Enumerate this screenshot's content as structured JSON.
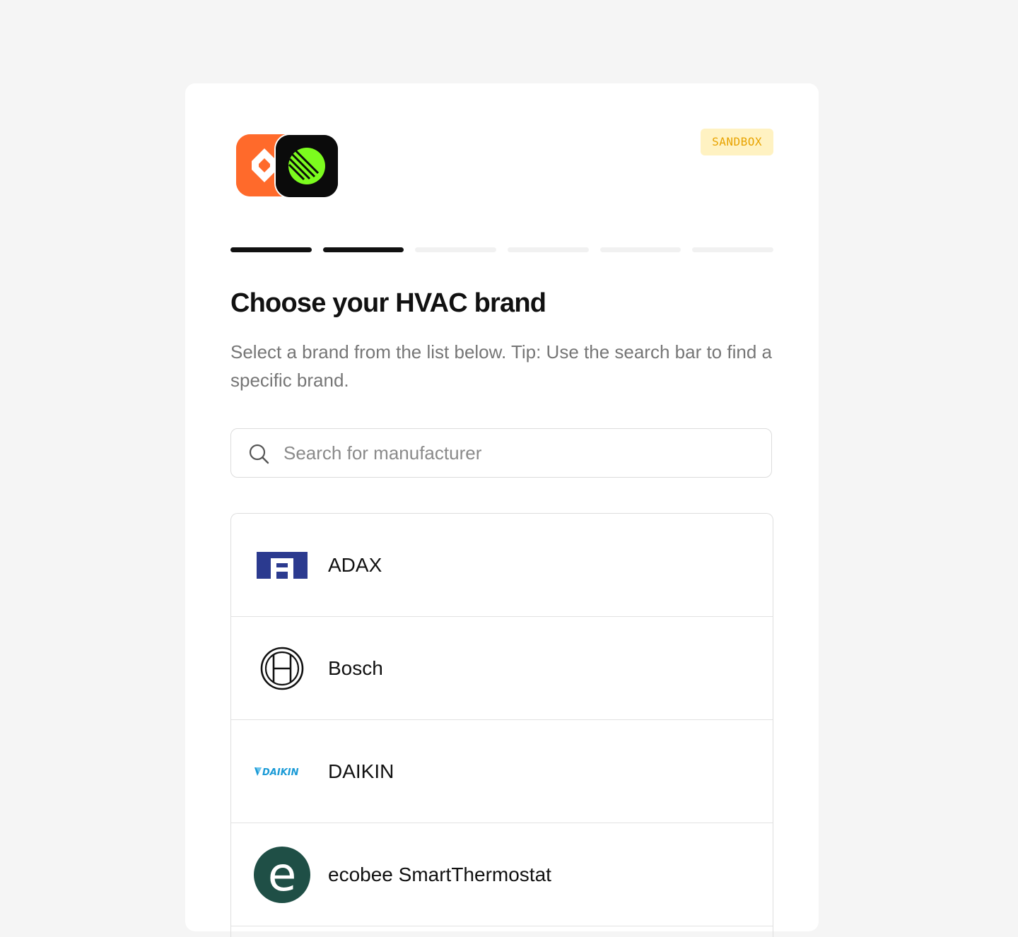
{
  "header": {
    "badge": "SANDBOX"
  },
  "progress": {
    "total_steps": 6,
    "completed_steps": 2
  },
  "main": {
    "title": "Choose your HVAC brand",
    "subtitle": "Select a brand from the list below. Tip: Use the search bar to find a specific brand."
  },
  "search": {
    "placeholder": "Search for manufacturer",
    "value": ""
  },
  "brands": [
    {
      "name": "ADAX",
      "logo": "adax-logo"
    },
    {
      "name": "Bosch",
      "logo": "bosch-logo"
    },
    {
      "name": "DAIKIN",
      "logo": "daikin-logo",
      "logo_text": "DAIKIN"
    },
    {
      "name": "ecobee SmartThermostat",
      "logo": "ecobee-logo",
      "logo_text": "e"
    }
  ],
  "colors": {
    "background": "#f5f5f5",
    "card": "#ffffff",
    "badge_bg": "#fff2c2",
    "badge_text": "#e8a300",
    "progress_done": "#111111",
    "progress_todo": "#f1f1f1",
    "app_logo_orange": "#ff6a2b",
    "app_logo_green": "#7cfc1e",
    "adax_blue": "#2b3a8f",
    "daikin_blue": "#1a9ad6",
    "ecobee_teal": "#1f4f46"
  }
}
